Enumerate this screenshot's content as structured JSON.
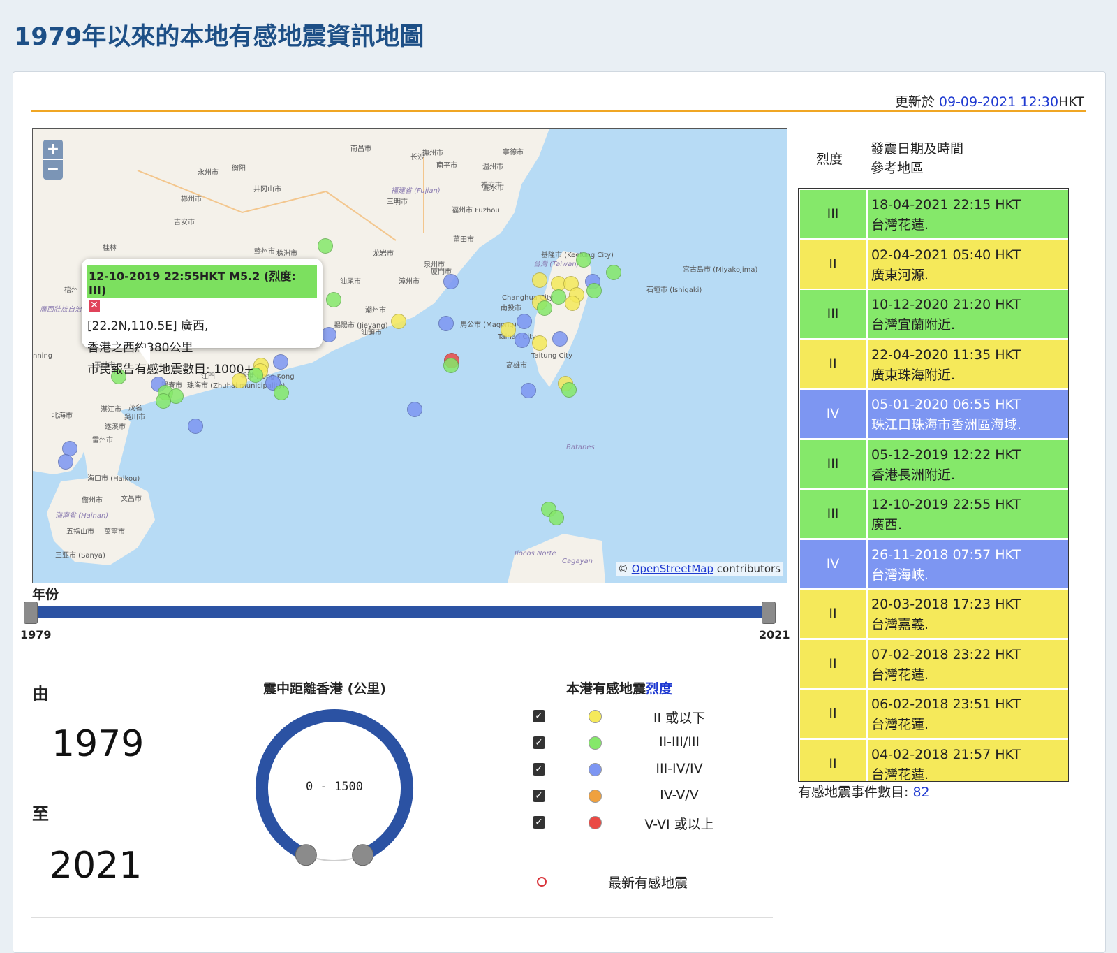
{
  "title": "1979年以來的本地有感地震資訊地圖",
  "updated": {
    "prefix": "更新於 ",
    "time": "09-09-2021 12:30",
    "suffix": "HKT"
  },
  "colors": {
    "yellow": "#f5e95a",
    "green": "#85e86a",
    "blue": "#7d96f2",
    "orange": "#f0a13e",
    "red": "#ea4a45",
    "title_blue": "#1d4f86",
    "slider_blue": "#2b52a3"
  },
  "map": {
    "zoom_in": "+",
    "zoom_out": "−",
    "attribution_prefix": "© ",
    "attribution_link": "OpenStreetMap",
    "attribution_suffix": " contributors",
    "places": [
      "桂林",
      "梧州",
      "玉林市",
      "北海市",
      "湛江市",
      "茂名",
      "吳川市",
      "遂溪市",
      "雷州市",
      "海口市 (Haikou)",
      "儋州市",
      "文昌市",
      "海南省 (Hainan)",
      "五指山市",
      "萬寧市",
      "三亚市 (Sanya)",
      "陽春市",
      "江門",
      "珠海市 (Zhuhai municipality)",
      "香港 Hong Kong",
      "廣州市",
      "汕尾市",
      "揭陽市 (Jieyang)",
      "汕頭市",
      "潮州市",
      "漳州市",
      "廈門市",
      "泉州市",
      "莆田市",
      "福州市 Fuzhou",
      "福建省 (Fujian)",
      "三明市",
      "龙岩市",
      "赣州市",
      "吉安市",
      "井冈山市",
      "郴州市",
      "永州市",
      "衡阳",
      "株洲市",
      "长沙",
      "南昌市",
      "撫州市",
      "南平市",
      "寧德市",
      "福安市",
      "温州市",
      "麗水市",
      "台灣 (Taiwan)",
      "基隆市 (Keelung City)",
      "Changhua City",
      "南投市",
      "馬公市 (Magong)",
      "Tainan City",
      "Taitung City",
      "高雄市",
      "宮古島市 (Miyakojima)",
      "石垣市 (Ishigaki)",
      "Batanes",
      "Ilocos Norte",
      "Cagayan",
      "廣西壯族自治區",
      "nning"
    ],
    "popup": {
      "header": "12-10-2019 22:55HKT M5.2 (烈度: III)",
      "close": "✕",
      "line1": "[22.2N,110.5E] 廣西,",
      "line2": "香港之西約380公里",
      "line3": "市民報告有感地震數目: 1000+"
    }
  },
  "year_slider": {
    "label": "年份",
    "min": "1979",
    "max": "2021",
    "from": 1979,
    "to": 2021
  },
  "range_summary": {
    "from_label": "由",
    "from_year": "1979",
    "to_label": "至",
    "to_year": "2021"
  },
  "distance": {
    "title": "震中距離香港 (公里)",
    "range_text": "0 - 1500",
    "min_km": 0,
    "max_km": 1500
  },
  "legend": {
    "title_prefix": "本港有感地震",
    "title_link": "烈度",
    "check": "✓",
    "items": [
      {
        "label": "II 或以下",
        "color": "yellow",
        "checked": true
      },
      {
        "label": "II-III/III",
        "color": "green",
        "checked": true
      },
      {
        "label": "III-IV/IV",
        "color": "blue",
        "checked": true
      },
      {
        "label": "IV-V/V",
        "color": "orange",
        "checked": true
      },
      {
        "label": "V-VI 或以上",
        "color": "red",
        "checked": true
      }
    ],
    "latest_label": "最新有感地震"
  },
  "table": {
    "col_intensity": "烈度",
    "col_date_line1": "發震日期及時間",
    "col_date_line2": "參考地區",
    "rows": [
      {
        "intensity": "III",
        "datetime": "18-04-2021 22:15 HKT",
        "region": "台灣花蓮.",
        "color": "green"
      },
      {
        "intensity": "II",
        "datetime": "02-04-2021 05:40 HKT",
        "region": "廣東河源.",
        "color": "yellow"
      },
      {
        "intensity": "III",
        "datetime": "10-12-2020 21:20 HKT",
        "region": "台灣宜蘭附近.",
        "color": "green"
      },
      {
        "intensity": "II",
        "datetime": "22-04-2020 11:35 HKT",
        "region": "廣東珠海附近.",
        "color": "yellow"
      },
      {
        "intensity": "IV",
        "datetime": "05-01-2020 06:55 HKT",
        "region": "珠江口珠海市香洲區海域.",
        "color": "blue"
      },
      {
        "intensity": "III",
        "datetime": "05-12-2019 12:22 HKT",
        "region": "香港長洲附近.",
        "color": "green"
      },
      {
        "intensity": "III",
        "datetime": "12-10-2019 22:55 HKT",
        "region": "廣西.",
        "color": "green"
      },
      {
        "intensity": "IV",
        "datetime": "26-11-2018 07:57 HKT",
        "region": "台灣海峽.",
        "color": "blue"
      },
      {
        "intensity": "II",
        "datetime": "20-03-2018 17:23 HKT",
        "region": "台灣嘉義.",
        "color": "yellow"
      },
      {
        "intensity": "II",
        "datetime": "07-02-2018 23:22 HKT",
        "region": "台灣花蓮.",
        "color": "yellow"
      },
      {
        "intensity": "II",
        "datetime": "06-02-2018 23:51 HKT",
        "region": "台灣花蓮.",
        "color": "yellow"
      },
      {
        "intensity": "II",
        "datetime": "04-02-2018 21:57 HKT",
        "region": "台灣花蓮.",
        "color": "yellow"
      }
    ],
    "count_label": "有感地震事件數目: ",
    "count": "82"
  }
}
